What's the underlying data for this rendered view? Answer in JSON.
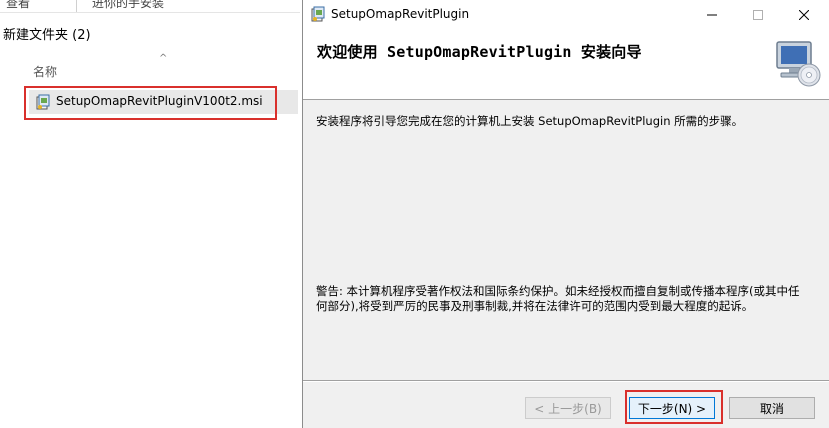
{
  "explorer": {
    "ribbon_items": [
      "查看",
      "进你的手安装"
    ],
    "folder_title": "新建文件夹 (2)",
    "sort_indicator": "^",
    "column_name": "名称",
    "file": {
      "name": "SetupOmapRevitPluginV100t2.msi",
      "icon": "msi-installer-icon"
    }
  },
  "installer": {
    "window_title": "SetupOmapRevitPlugin",
    "controls": {
      "minimize": "—",
      "maximize": "☐",
      "close": "✕"
    },
    "banner_title": "欢迎使用 SetupOmapRevitPlugin 安装向导",
    "banner_icon": "computer-cd-icon",
    "intro_text": "安装程序将引导您完成在您的计算机上安装 SetupOmapRevitPlugin 所需的步骤。",
    "warning_text": "警告: 本计算机程序受著作权法和国际条约保护。如未经授权而擅自复制或传播本程序(或其中任何部分),将受到严厉的民事及刑事制裁,并将在法律许可的范围内受到最大程度的起诉。",
    "buttons": {
      "back": "< 上一步(B)",
      "next": "下一步(N) >",
      "cancel": "取消"
    }
  },
  "colors": {
    "highlight_box": "#d9302c",
    "focus_border": "#0078d7"
  }
}
